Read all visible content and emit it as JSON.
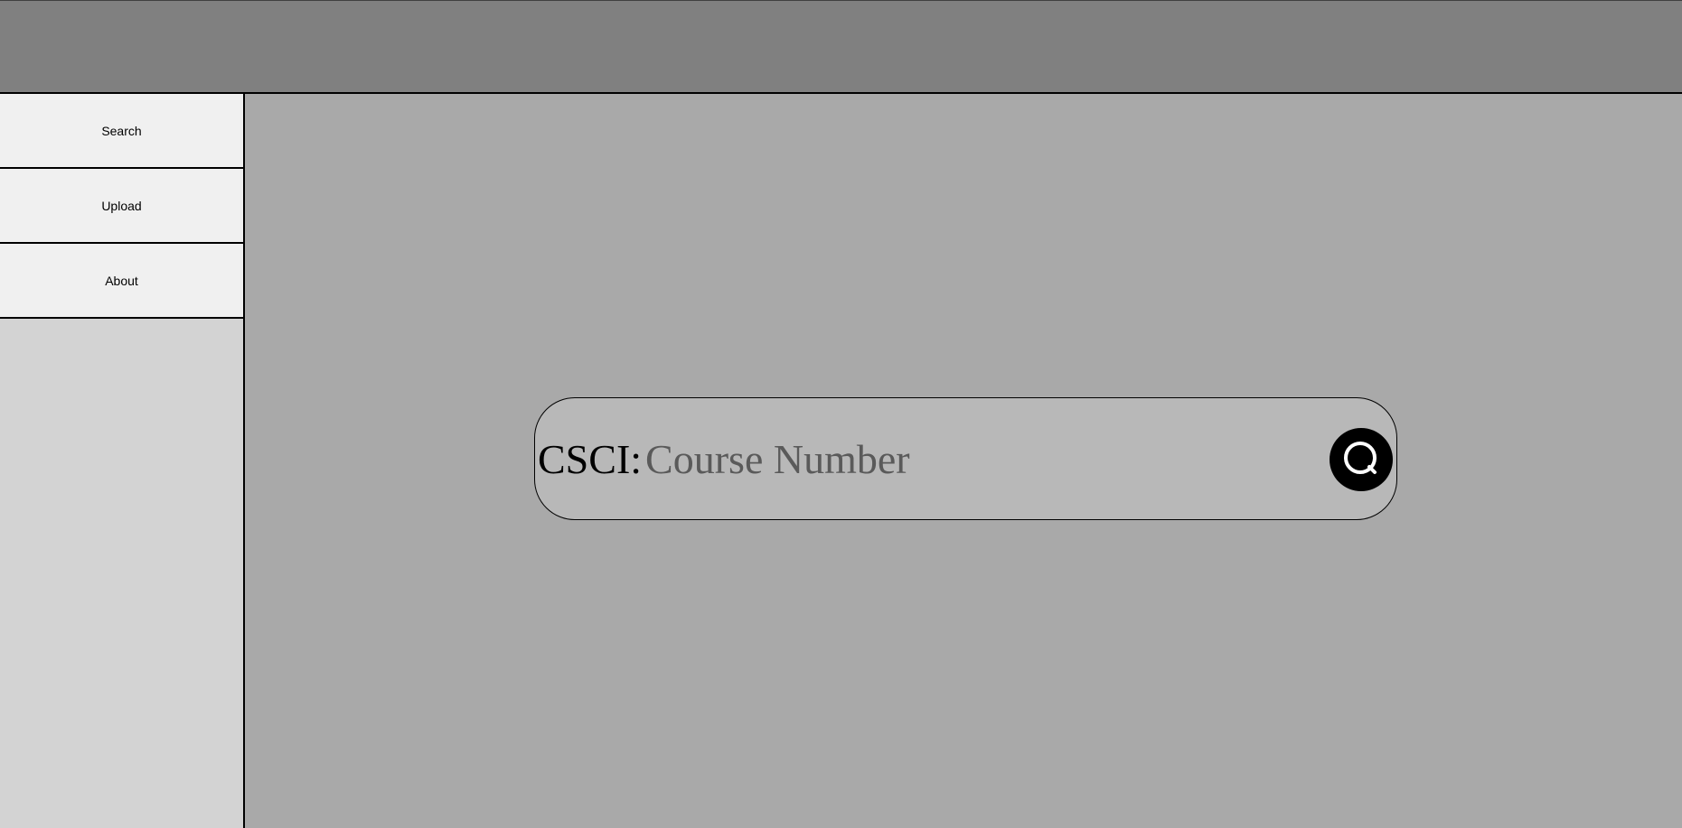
{
  "sidebar": {
    "items": [
      {
        "label": "Search"
      },
      {
        "label": "Upload"
      },
      {
        "label": "About"
      }
    ]
  },
  "search": {
    "prefix": "CSCI:",
    "placeholder": "Course Number",
    "value": "",
    "button_icon": "search-icon"
  },
  "colors": {
    "header": "#808080",
    "sidebar": "#d3d3d3",
    "nav_item": "#f0f0f0",
    "main": "#a9a9a9",
    "search_box": "#b8b8b8",
    "search_button": "#000000"
  }
}
